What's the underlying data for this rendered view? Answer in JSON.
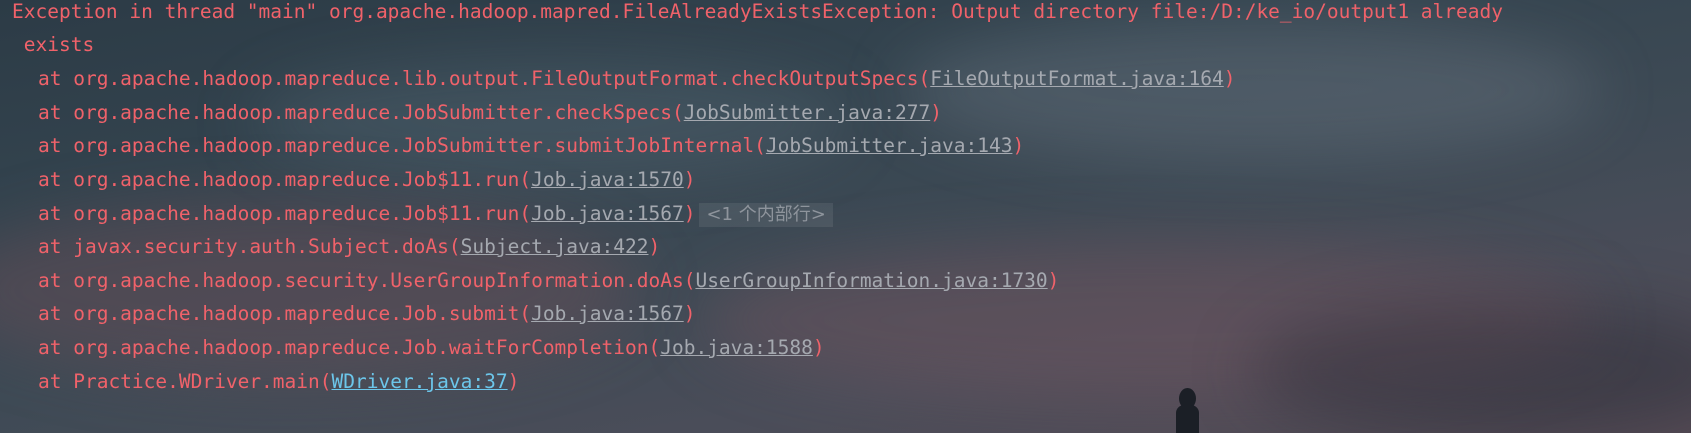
{
  "console": {
    "exception_line1": "Exception in thread \"main\" org.apache.hadoop.mapred.FileAlreadyExistsException: Output directory file:/D:/ke_io/output1 already",
    "exception_line2": " exists",
    "frames": [
      {
        "method": "at org.apache.hadoop.mapreduce.lib.output.FileOutputFormat.checkOutputSpecs(",
        "link": "FileOutputFormat.java:164",
        "close": ")"
      },
      {
        "method": "at org.apache.hadoop.mapreduce.JobSubmitter.checkSpecs(",
        "link": "JobSubmitter.java:277",
        "close": ")"
      },
      {
        "method": "at org.apache.hadoop.mapreduce.JobSubmitter.submitJobInternal(",
        "link": "JobSubmitter.java:143",
        "close": ")"
      },
      {
        "method": "at org.apache.hadoop.mapreduce.Job$11.run(",
        "link": "Job.java:1570",
        "close": ")"
      },
      {
        "method": "at org.apache.hadoop.mapreduce.Job$11.run(",
        "link": "Job.java:1567",
        "close": ")",
        "folded": "<1 个内部行>"
      },
      {
        "method": "at javax.security.auth.Subject.doAs(",
        "link": "Subject.java:422",
        "close": ")"
      },
      {
        "method": "at org.apache.hadoop.security.UserGroupInformation.doAs(",
        "link": "UserGroupInformation.java:1730",
        "close": ")"
      },
      {
        "method": "at org.apache.hadoop.mapreduce.Job.submit(",
        "link": "Job.java:1567",
        "close": ")"
      },
      {
        "method": "at org.apache.hadoop.mapreduce.Job.waitForCompletion(",
        "link": "Job.java:1588",
        "close": ")"
      },
      {
        "method": "at Practice.WDriver.main(",
        "link": "WDriver.java:37",
        "close": ")"
      }
    ]
  },
  "colors": {
    "error_text": "#f0626a",
    "library_link": "#a5a9b0",
    "project_link": "#6cc6ea"
  }
}
